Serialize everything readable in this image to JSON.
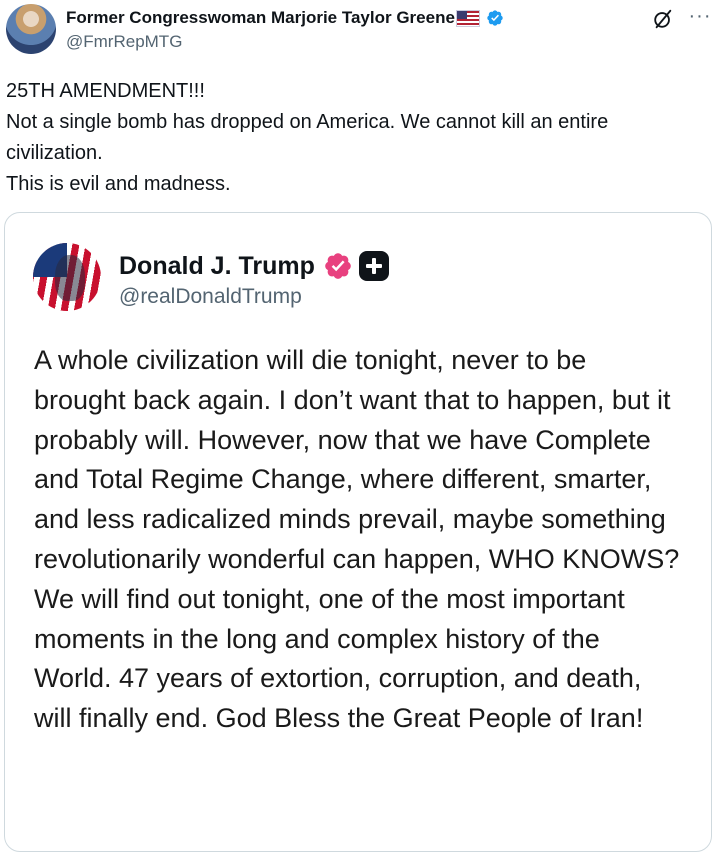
{
  "post": {
    "author_name": "Former Congresswoman Marjorie Taylor Greene",
    "author_handle": "@FmrRepMTG",
    "flag_icon": "us-flag-emoji",
    "verified_color": "#1d9bf0",
    "more_label": "···",
    "text_lines": [
      "25TH AMENDMENT!!!",
      "Not a single bomb has dropped on America. We cannot kill an entire civilization.",
      "This is evil and madness."
    ]
  },
  "quote": {
    "author_name": "Donald J. Trump",
    "author_handle": "@realDonaldTrump",
    "badge_color": "#e8417f",
    "plus_icon": "truth-plus-icon",
    "text": "A whole civilization will die tonight, never to be brought back again. I don’t want that to happen, but it probably will. However, now that we have Complete and Total Regime Change, where different, smarter, and less radicalized minds prevail, maybe something revolutionarily wonderful can happen, WHO KNOWS? We will find out tonight, one of the most important moments in the long and complex history of the World. 47 years of extortion, corruption, and death, will finally end. God Bless the Great People of Iran!"
  }
}
